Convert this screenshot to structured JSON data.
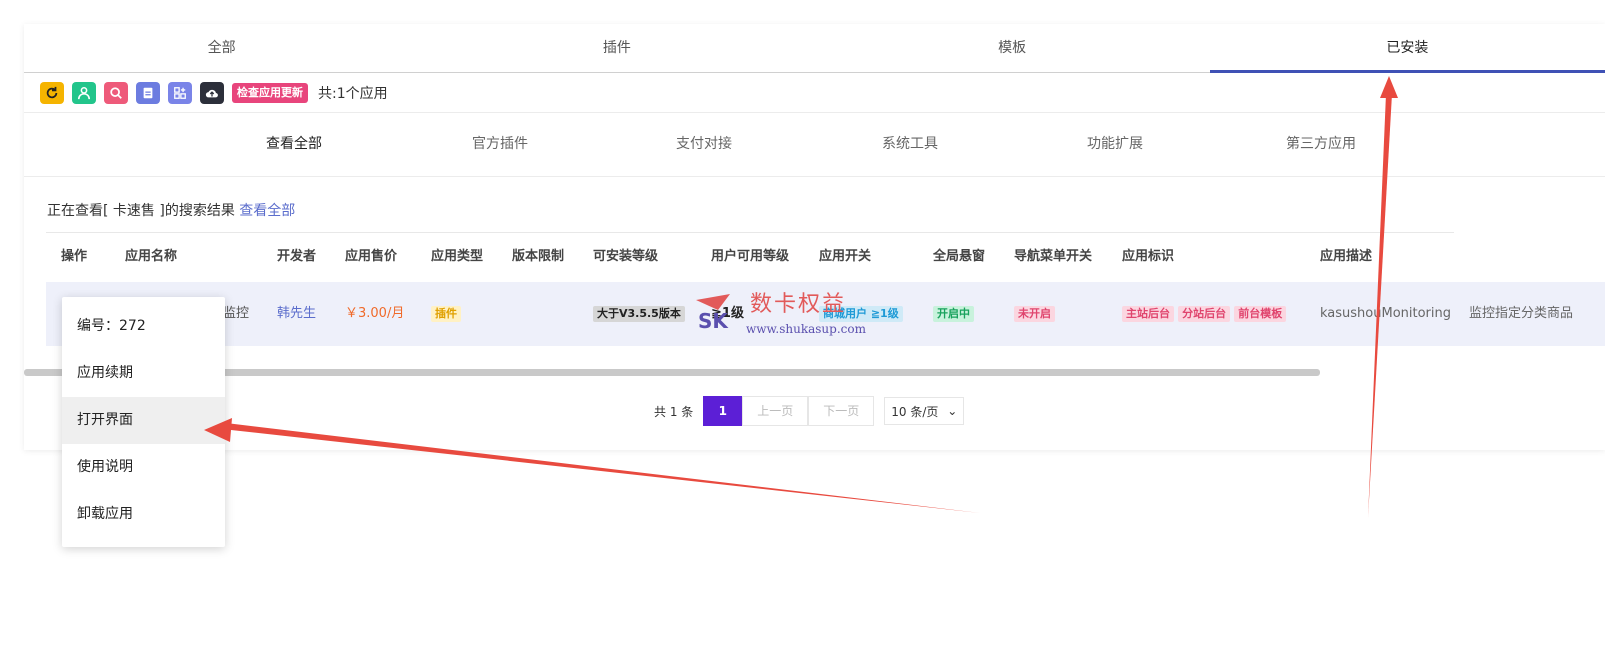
{
  "tabs": [
    {
      "label": "全部"
    },
    {
      "label": "插件"
    },
    {
      "label": "模板"
    },
    {
      "label": "已安装"
    }
  ],
  "toolbar": {
    "buttons": [
      {
        "icon": "refresh-icon",
        "color": "#f5b400"
      },
      {
        "icon": "user-icon",
        "color": "#22c58b"
      },
      {
        "icon": "search-icon",
        "color": "#ee5a7a"
      },
      {
        "icon": "document-icon",
        "color": "#6c7ce0"
      },
      {
        "icon": "grid-plus-icon",
        "color": "#7a84e8"
      },
      {
        "icon": "cloud-upload-icon",
        "color": "#2c2f3a"
      }
    ],
    "update_label": "检查应用更新",
    "count_text": "共:1个应用"
  },
  "categories": [
    {
      "label": "查看全部"
    },
    {
      "label": "官方插件"
    },
    {
      "label": "支付对接"
    },
    {
      "label": "系统工具"
    },
    {
      "label": "功能扩展"
    },
    {
      "label": "第三方应用"
    }
  ],
  "search": {
    "prefix": "正在查看[ 卡速售 ]的搜索结果 ",
    "view_all": "查看全部"
  },
  "table": {
    "headers": [
      "操作",
      "应用名称",
      "开发者",
      "应用售价",
      "应用类型",
      "版本限制",
      "可安装等级",
      "用户可用等级",
      "应用开关",
      "全局悬窗",
      "导航菜单开关",
      "应用标识",
      "应用描述"
    ],
    "row": {
      "name_fragment": "监控",
      "developer": "韩先生",
      "price": "￥3.00/月",
      "type": "插件",
      "install_level": "大于V3.5.5版本",
      "install_level2": "≧1级",
      "user_level": "商城用户 ≧1级",
      "switch": "开启中",
      "float_window": "未开启",
      "tags": [
        "主站后台",
        "分站后台",
        "前台模板"
      ],
      "identifier": "kasushouMonitoring",
      "description": "监控指定分类商品"
    }
  },
  "pagination": {
    "total": "共 1 条",
    "current": "1",
    "prev": "上一页",
    "next": "下一页",
    "per_page": "10 条/页"
  },
  "context_menu": {
    "items": [
      {
        "label": "编号：272"
      },
      {
        "label": "应用续期"
      },
      {
        "label": "打开界面"
      },
      {
        "label": "使用说明"
      },
      {
        "label": "卸载应用"
      }
    ]
  },
  "watermark": {
    "text": "数卡权益",
    "url": "www.shukasup.com"
  }
}
